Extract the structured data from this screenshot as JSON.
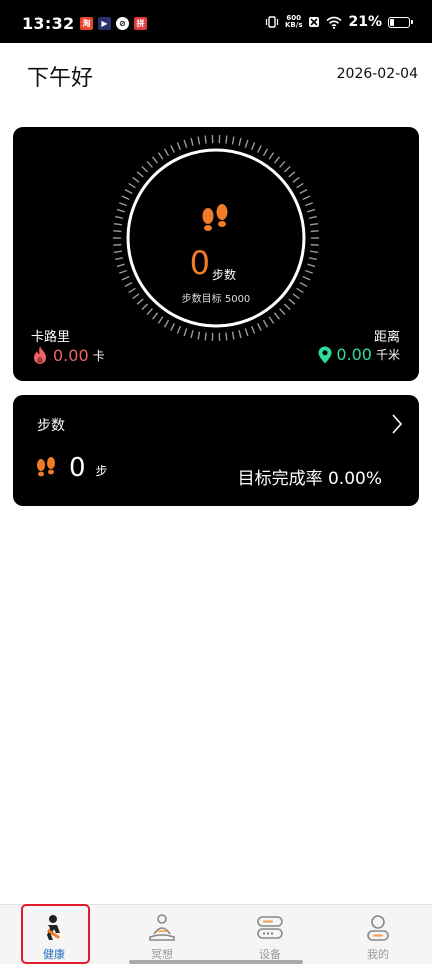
{
  "status_bar": {
    "time": "13:32",
    "net_speed_value": "600",
    "net_speed_unit": "KB/s",
    "battery_percent_text": "21%",
    "battery_level": 0.21,
    "app_icons": [
      "notification-app-1-icon",
      "notification-app-2-icon",
      "notification-app-3-icon",
      "notification-app-4-icon"
    ]
  },
  "header": {
    "greeting": "下午好",
    "date": "2026-02-04"
  },
  "summary_card": {
    "steps_value": "0",
    "steps_unit": "步数",
    "steps_goal": "步数目标 5000",
    "calories_label": "卡路里",
    "calories_value": "0.00",
    "calories_unit": "卡",
    "distance_label": "距离",
    "distance_value": "0.00",
    "distance_unit": "千米",
    "progress": 0,
    "colors": {
      "steps": "#f07c27",
      "calories": "#f06265",
      "distance": "#2fdc9c"
    }
  },
  "steps_card": {
    "title": "步数",
    "value": "0",
    "unit": "步",
    "goal_rate": "目标完成率 0.00%"
  },
  "bottom_nav": {
    "items": [
      {
        "label": "健康",
        "icon": "health-runner-icon",
        "active": true
      },
      {
        "label": "冥想",
        "icon": "meditation-icon",
        "active": false
      },
      {
        "label": "设备",
        "icon": "device-icon",
        "active": false
      },
      {
        "label": "我的",
        "icon": "profile-icon",
        "active": false
      }
    ],
    "active_color": "#1f6fbf"
  }
}
